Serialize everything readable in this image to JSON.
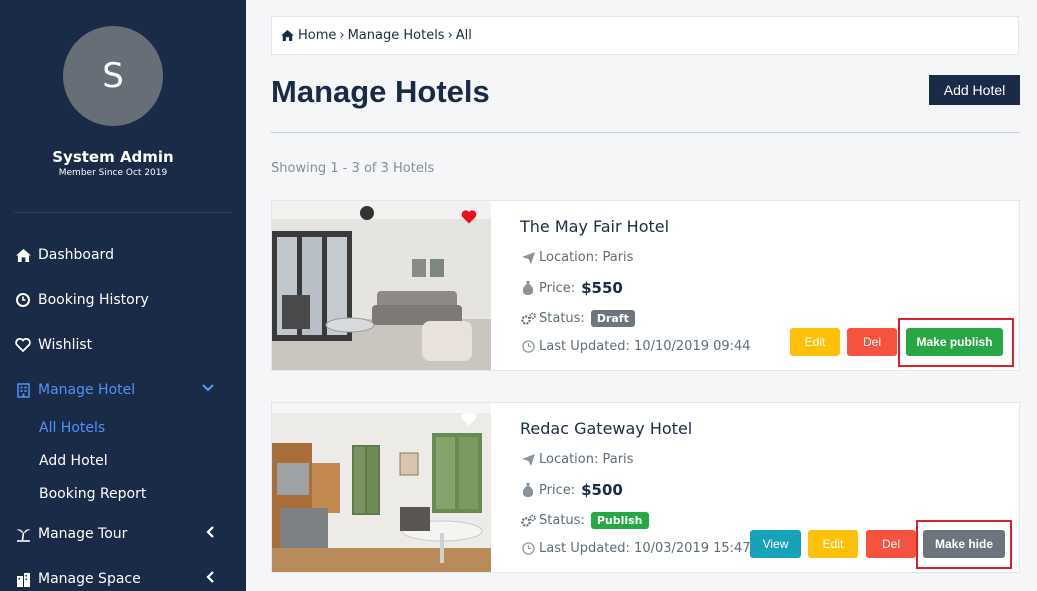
{
  "user": {
    "initial": "S",
    "name": "System Admin",
    "member_since": "Member Since Oct 2019"
  },
  "sidebar": {
    "items": [
      {
        "label": "Dashboard",
        "icon": "home-icon"
      },
      {
        "label": "Booking History",
        "icon": "clock-icon"
      },
      {
        "label": "Wishlist",
        "icon": "heart-outline-icon"
      },
      {
        "label": "Manage Hotel",
        "icon": "building-icon"
      },
      {
        "label": "Manage Tour",
        "icon": "palm-tree-icon"
      },
      {
        "label": "Manage Space",
        "icon": "city-icon"
      }
    ],
    "hotel_submenu": [
      "All Hotels",
      "Add Hotel",
      "Booking Report"
    ]
  },
  "breadcrumb": [
    "Home",
    "Manage Hotels",
    "All"
  ],
  "page": {
    "title": "Manage Hotels",
    "add_button": "Add Hotel",
    "showing": "Showing 1 - 3 of 3 Hotels"
  },
  "hotels": [
    {
      "name": "The May Fair Hotel",
      "location": "Location: Paris",
      "price_label": "Price:",
      "price": "$550",
      "status_label": "Status:",
      "status": "Draft",
      "updated": "Last Updated: 10/10/2019 09:44",
      "wishlisted": true,
      "buttons": {
        "edit": "Edit",
        "del": "Del",
        "toggle": "Make publish"
      }
    },
    {
      "name": "Redac Gateway Hotel",
      "location": "Location: Paris",
      "price_label": "Price:",
      "price": "$500",
      "status_label": "Status:",
      "status": "Publish",
      "updated": "Last Updated: 10/03/2019 15:47",
      "wishlisted": false,
      "buttons": {
        "view": "View",
        "edit": "Edit",
        "del": "Del",
        "toggle": "Make hide"
      }
    }
  ],
  "colors": {
    "sidebar_bg": "#1a2b48",
    "accent": "#5191fa",
    "highlight": "#d9202b"
  }
}
